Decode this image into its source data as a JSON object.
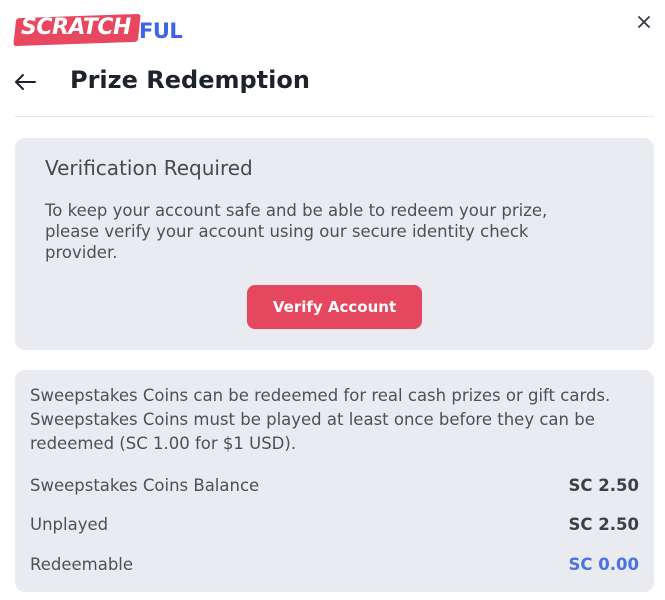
{
  "brand": {
    "logo_part1": "SCRATCH",
    "logo_part2": "FUL",
    "primary_color": "#e5475f",
    "accent_color": "#3d63e6"
  },
  "header": {
    "title": "Prize Redemption",
    "back_icon": "arrow-left-icon",
    "close_icon": "close-icon"
  },
  "verification": {
    "title": "Verification Required",
    "message": "To keep your account safe and be able to redeem your prize, please verify your account using our secure identity check provider.",
    "button_label": "Verify Account"
  },
  "info": {
    "description": "Sweepstakes Coins can be redeemed for real cash prizes or gift cards. Sweepstakes Coins must be played at least once before they can be redeemed (SC 1.00 for $1 USD).",
    "rows": [
      {
        "label": "Sweepstakes Coins Balance",
        "value": "SC 2.50"
      },
      {
        "label": "Unplayed",
        "value": "SC 2.50"
      },
      {
        "label": "Redeemable",
        "value": "SC 0.00"
      }
    ]
  }
}
